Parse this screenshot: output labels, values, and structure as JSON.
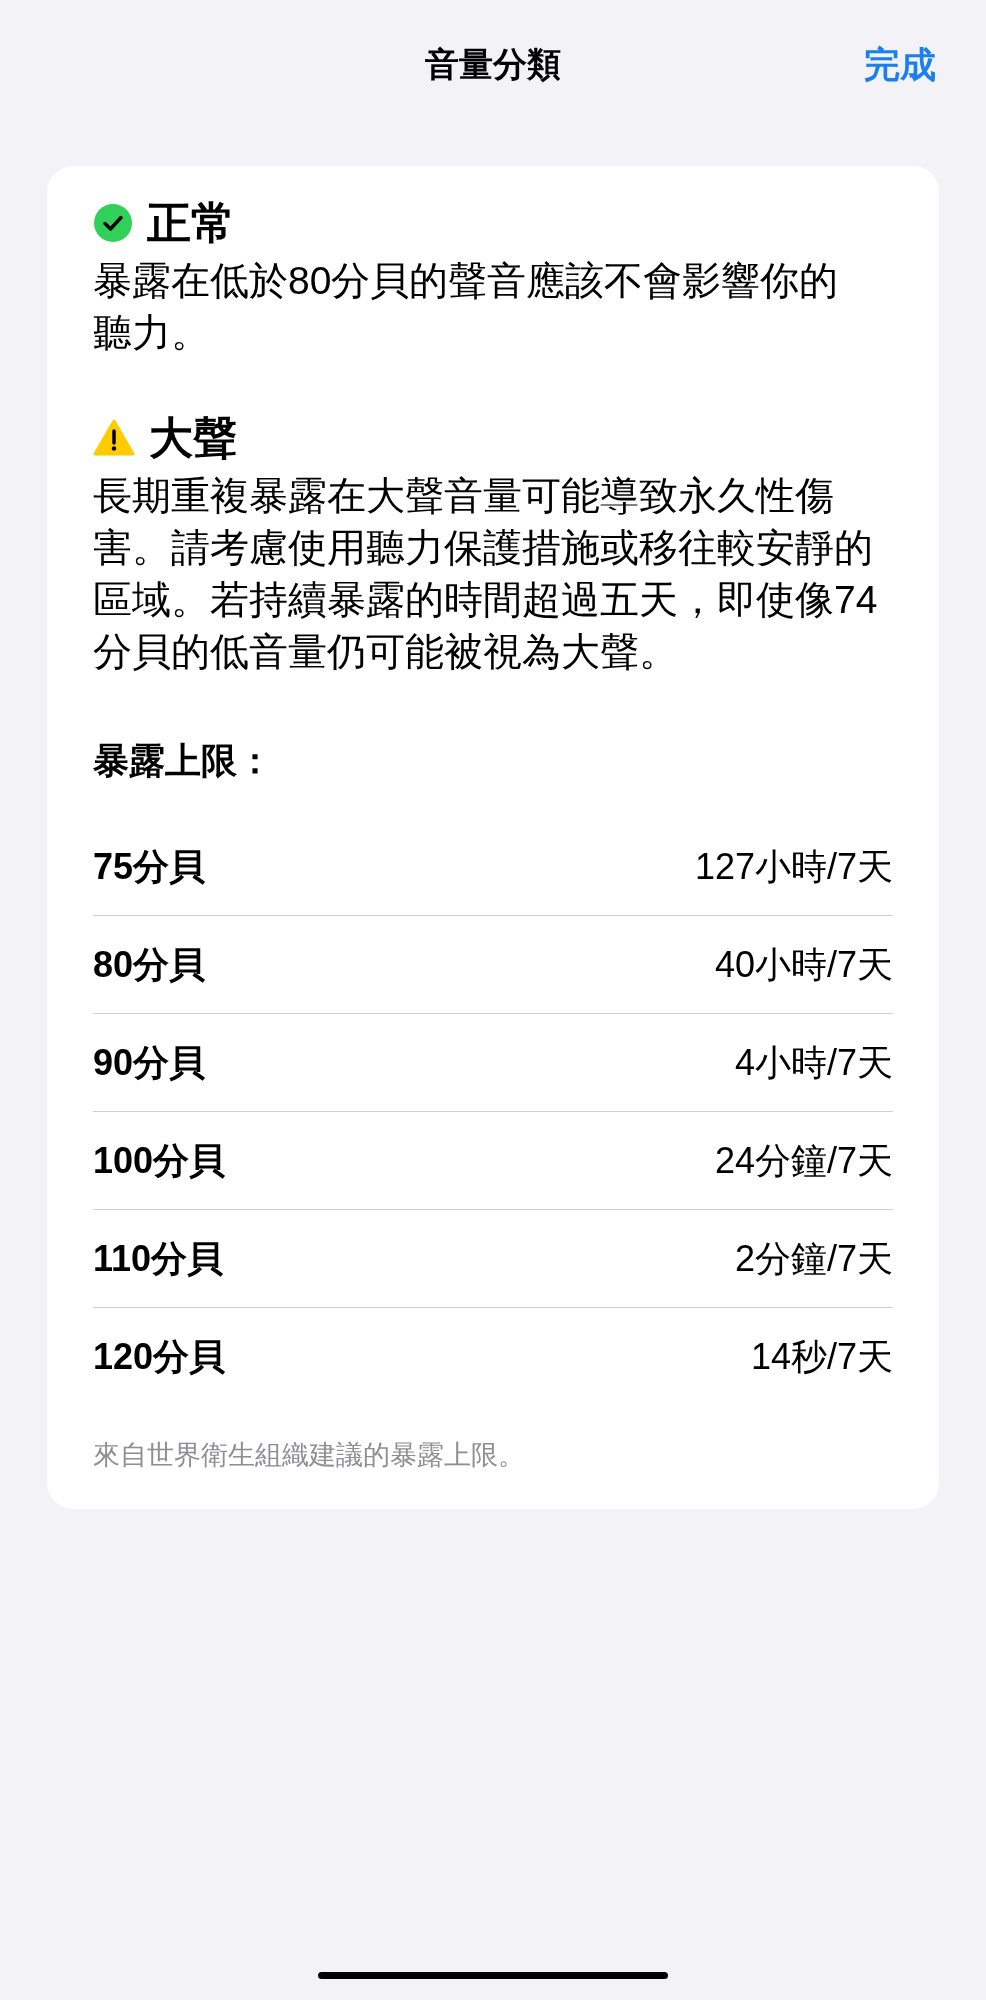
{
  "nav": {
    "title": "音量分類",
    "done": "完成"
  },
  "categories": [
    {
      "kind": "ok",
      "title": "正常",
      "description": "暴露在低於80分貝的聲音應該不會影響你的聽力。"
    },
    {
      "kind": "warning",
      "title": "大聲",
      "description": "長期重複暴露在大聲音量可能導致永久性傷害。請考慮使用聽力保護措施或移往較安靜的區域。若持續暴露的時間超過五天，即使像74分貝的低音量仍可能被視為大聲。"
    }
  ],
  "limits": {
    "title": "暴露上限：",
    "rows": [
      {
        "decibels": "75分貝",
        "limit": "127小時/7天"
      },
      {
        "decibels": "80分貝",
        "limit": "40小時/7天"
      },
      {
        "decibels": "90分貝",
        "limit": "4小時/7天"
      },
      {
        "decibels": "100分貝",
        "limit": "24分鐘/7天"
      },
      {
        "decibels": "110分貝",
        "limit": "2分鐘/7天"
      },
      {
        "decibels": "120分貝",
        "limit": "14秒/7天"
      }
    ]
  },
  "footer": "來自世界衛生組織建議的暴露上限。"
}
